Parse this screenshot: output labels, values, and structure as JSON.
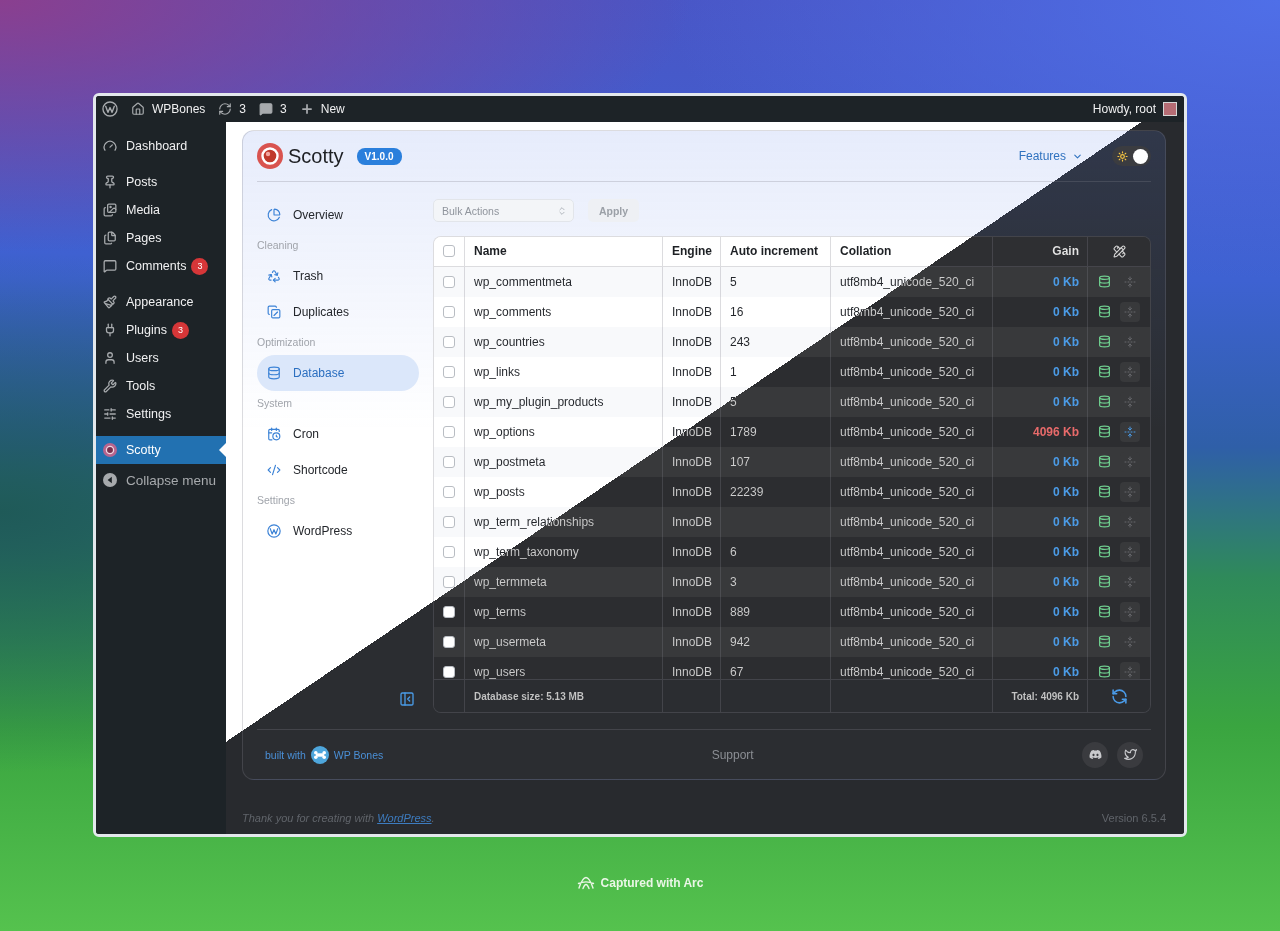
{
  "admin_bar": {
    "site": "WPBones",
    "updates": "3",
    "comments": "3",
    "new": "New",
    "greeting": "Howdy, root"
  },
  "admin_menu": {
    "groups": [
      {
        "items": [
          {
            "label": "Dashboard",
            "selected": false
          }
        ]
      },
      {
        "items": [
          {
            "label": "Posts",
            "selected": false
          },
          {
            "label": "Media",
            "selected": false
          },
          {
            "label": "Pages",
            "selected": false
          },
          {
            "label": "Comments",
            "selected": false,
            "badge": "3"
          }
        ]
      },
      {
        "items": [
          {
            "label": "Appearance",
            "selected": false
          },
          {
            "label": "Plugins",
            "selected": false,
            "badge": "3"
          },
          {
            "label": "Users",
            "selected": false
          },
          {
            "label": "Tools",
            "selected": false
          },
          {
            "label": "Settings",
            "selected": false
          }
        ]
      },
      {
        "items": [
          {
            "label": "Scotty",
            "selected": true
          }
        ]
      }
    ],
    "collapse": "Collapse menu"
  },
  "header": {
    "title": "Scotty",
    "version": "V1.0.0",
    "features": "Features",
    "theme_toggle": {
      "on": true
    }
  },
  "nav": [
    {
      "items": [
        {
          "label": "Overview",
          "selected": false
        }
      ]
    },
    {
      "heading": "Cleaning",
      "items": [
        {
          "label": "Trash",
          "selected": false
        },
        {
          "label": "Duplicates",
          "selected": false
        }
      ]
    },
    {
      "heading": "Optimization",
      "items": [
        {
          "label": "Database",
          "selected": true
        }
      ]
    },
    {
      "heading": "System",
      "items": [
        {
          "label": "Cron",
          "selected": false
        },
        {
          "label": "Shortcode",
          "selected": false
        }
      ]
    },
    {
      "heading": "Settings",
      "items": [
        {
          "label": "WordPress",
          "selected": false
        }
      ]
    }
  ],
  "toolbar": {
    "bulk_actions": {
      "value": "Bulk Actions",
      "disabled": true
    },
    "apply": {
      "label": "Apply",
      "disabled": true
    }
  },
  "table": {
    "select_all": {
      "checked": false
    },
    "columns": [
      "Name",
      "Engine",
      "Auto increment",
      "Collation",
      "Gain"
    ],
    "rows": [
      {
        "checked": false,
        "name": "wp_commentmeta",
        "engine": "InnoDB",
        "auto_increment": "5",
        "collation": "utf8mb4_unicode_520_ci",
        "gain": "0 Kb",
        "optimizable": false
      },
      {
        "checked": false,
        "name": "wp_comments",
        "engine": "InnoDB",
        "auto_increment": "16",
        "collation": "utf8mb4_unicode_520_ci",
        "gain": "0 Kb",
        "optimizable": false
      },
      {
        "checked": false,
        "name": "wp_countries",
        "engine": "InnoDB",
        "auto_increment": "243",
        "collation": "utf8mb4_unicode_520_ci",
        "gain": "0 Kb",
        "optimizable": false
      },
      {
        "checked": false,
        "name": "wp_links",
        "engine": "InnoDB",
        "auto_increment": "1",
        "collation": "utf8mb4_unicode_520_ci",
        "gain": "0 Kb",
        "optimizable": false
      },
      {
        "checked": false,
        "name": "wp_my_plugin_products",
        "engine": "InnoDB",
        "auto_increment": "5",
        "collation": "utf8mb4_unicode_520_ci",
        "gain": "0 Kb",
        "optimizable": false
      },
      {
        "checked": false,
        "name": "wp_options",
        "engine": "InnoDB",
        "auto_increment": "1789",
        "collation": "utf8mb4_unicode_520_ci",
        "gain": "4096 Kb",
        "optimizable": true
      },
      {
        "checked": false,
        "name": "wp_postmeta",
        "engine": "InnoDB",
        "auto_increment": "107",
        "collation": "utf8mb4_unicode_520_ci",
        "gain": "0 Kb",
        "optimizable": false
      },
      {
        "checked": false,
        "name": "wp_posts",
        "engine": "InnoDB",
        "auto_increment": "22239",
        "collation": "utf8mb4_unicode_520_ci",
        "gain": "0 Kb",
        "optimizable": false
      },
      {
        "checked": false,
        "name": "wp_term_relationships",
        "engine": "InnoDB",
        "collation": "utf8mb4_unicode_520_ci",
        "gain": "0 Kb",
        "optimizable": false
      },
      {
        "checked": false,
        "name": "wp_term_taxonomy",
        "engine": "InnoDB",
        "auto_increment": "6",
        "collation": "utf8mb4_unicode_520_ci",
        "gain": "0 Kb",
        "optimizable": false
      },
      {
        "checked": false,
        "name": "wp_termmeta",
        "engine": "InnoDB",
        "auto_increment": "3",
        "collation": "utf8mb4_unicode_520_ci",
        "gain": "0 Kb",
        "optimizable": false
      },
      {
        "checked": false,
        "name": "wp_terms",
        "engine": "InnoDB",
        "auto_increment": "889",
        "collation": "utf8mb4_unicode_520_ci",
        "gain": "0 Kb",
        "optimizable": false
      },
      {
        "checked": false,
        "name": "wp_usermeta",
        "engine": "InnoDB",
        "auto_increment": "942",
        "collation": "utf8mb4_unicode_520_ci",
        "gain": "0 Kb",
        "optimizable": false
      },
      {
        "checked": false,
        "name": "wp_users",
        "engine": "InnoDB",
        "auto_increment": "67",
        "collation": "utf8mb4_unicode_520_ci",
        "gain": "0 Kb",
        "optimizable": false
      }
    ],
    "footer": {
      "database_size": "Database size: 5.13 MB",
      "total": "Total: 4096 Kb"
    }
  },
  "card_footer": {
    "built_with": "built with",
    "brand": "WP Bones",
    "support": "Support"
  },
  "page_footer": {
    "text": "Thank you for creating with",
    "link": "WordPress",
    "text_end": ".",
    "version": "Version 6.5.4"
  },
  "capture_label": "Captured with Arc"
}
